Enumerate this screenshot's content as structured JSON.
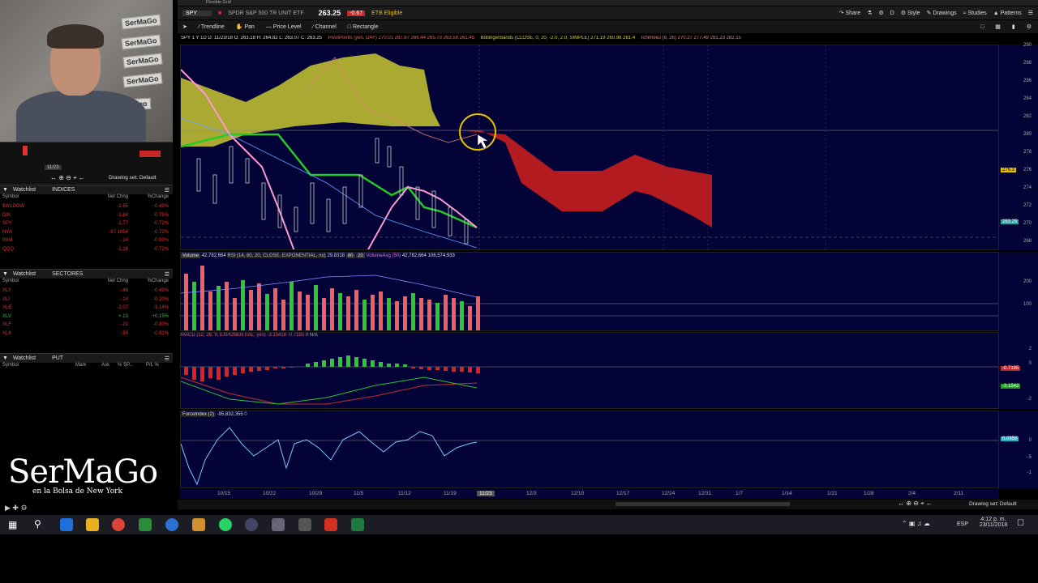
{
  "header": {
    "app_title": "Flexible Grid",
    "symbol": "SPY",
    "description": "SPDR S&P 500 TR UNIT ETF",
    "last_price": "263.25",
    "change_pct": "-0.67",
    "etb_label": "ETB Eligible",
    "share_label": "Share",
    "style_label": "Style",
    "drawings_label": "Drawings",
    "studies_label": "Studies",
    "patterns_label": "Patterns",
    "period_label": "D"
  },
  "drawing_tools": {
    "trendline": "Trendline",
    "pan": "Pan",
    "price_level": "Price Level",
    "channel": "Channel",
    "rectangle": "Rectangle"
  },
  "study_bar": {
    "ohlc": "SPY 1 Y 1D  D: 11/23/18  O: 263.18  H: 264.82  L: 263.07  C: 263.25",
    "pivot": "PivotPoints (yes, DAY)  270.01  267.87  266.44  265.73  263.59  261.45",
    "bollinger": "BollingerBands (CLOSE, 0, 20, -2.0, 2.0, SIMPLE)  271.19  260.98  281.4",
    "ichimoku": "Ichimoku (9, 26)  270.27  277.49  281.23  282.15"
  },
  "price_axis": [
    "290",
    "288",
    "286",
    "284",
    "282",
    "280",
    "278",
    "276",
    "274",
    "272",
    "270",
    "268"
  ],
  "price_tags": {
    "current": "263.25",
    "upper": "276.3"
  },
  "volume_pane": {
    "label": "Volume",
    "volume_value": "42,782,664",
    "rsi_label": "RSI (14, 80, 20, CLOSE, EXPONENTIAL, no)",
    "rsi_value": "29.8318",
    "rsi_hi": "80",
    "rsi_lo": "20",
    "volavg_label": "VolumeAvg (50)",
    "volavg_value": "42,782,664",
    "volavg2_value": "106,574,933",
    "axis": [
      "200",
      "100"
    ]
  },
  "macd_pane": {
    "label": "MACD (12, 26, 9, EXPONENTIAL, yes)",
    "value1": "-3.15418",
    "value2": "-0.7195",
    "value3": "0",
    "value4": "N/A",
    "axis_tag1": "-0.7195",
    "axis_tag2": "-3.1542",
    "axis": [
      "2",
      "0",
      "-2"
    ]
  },
  "force_pane": {
    "label": "ForceIndex (2)",
    "value": "-95,832,355",
    "zero": "0",
    "axis_tag": "0.0958",
    "axis": [
      "0",
      "-.5",
      "-1"
    ]
  },
  "date_axis": [
    "10/15",
    "10/22",
    "10/29",
    "11/5",
    "11/12",
    "11/19",
    "11/23",
    "12/3",
    "12/10",
    "12/17",
    "12/24",
    "12/31",
    "1/7",
    "1/14",
    "1/21",
    "1/28",
    "2/4",
    "2/11"
  ],
  "status": {
    "drawing_set_right": "Drawing set: Default",
    "drawing_set_left": "Drawing set: Default",
    "mini_date": "11/23"
  },
  "watchlists": [
    {
      "title": "Watchlist",
      "group": "INDICES",
      "cols": [
        "Symbol",
        "Net Chng",
        "%Change"
      ],
      "rows": [
        {
          "sym": "$W1DOW",
          "chg": "-1.65",
          "pct": "-0.45%"
        },
        {
          "sym": "DIA",
          "chg": "-1.84",
          "pct": "-0.75%"
        },
        {
          "sym": "SPY",
          "chg": "-1.77",
          "pct": "-0.72%"
        },
        {
          "sym": "NYA",
          "chg": "-87.1054",
          "pct": "-0.72%"
        },
        {
          "sym": "IWM",
          "chg": "-.14",
          "pct": "-0.09%"
        },
        {
          "sym": "QQQ",
          "chg": "-1.16",
          "pct": "-0.72%"
        }
      ]
    },
    {
      "title": "Watchlist",
      "group": "SECTORES",
      "cols": [
        "Symbol",
        "Net Chng",
        "%Change"
      ],
      "rows": [
        {
          "sym": "XLY",
          "chg": "-.46",
          "pct": "-0.45%"
        },
        {
          "sym": "XLI",
          "chg": "-.14",
          "pct": "-0.20%"
        },
        {
          "sym": "XLE",
          "chg": "-2.07",
          "pct": "-3.14%"
        },
        {
          "sym": "XLV",
          "chg": "+.13",
          "pct": "+0.15%"
        },
        {
          "sym": "XLF",
          "chg": "-.21",
          "pct": "-0.80%"
        },
        {
          "sym": "XLK",
          "chg": "-.59",
          "pct": "-0.91%"
        }
      ]
    },
    {
      "title": "Watchlist",
      "group": "PUT",
      "cols": [
        "Symbol",
        "Mark",
        "Ask",
        "% SP...",
        "P/L %"
      ],
      "rows": []
    }
  ],
  "brand": {
    "title": "SerMaGo",
    "subtitle": "en la Bolsa de New York"
  },
  "webcam_posters": [
    "SerMaGo",
    "SerMaGo",
    "SerMaGo",
    "SerMaGo",
    "Latinago"
  ],
  "taskbar": {
    "time": "4:12 p. m.",
    "date": "23/11/2018",
    "lang": "ESP"
  },
  "colors": {
    "pane_bg": "#030338",
    "cloud_bull": "#c8c832",
    "cloud_bear": "#c81e1e",
    "up": "#2ec82e",
    "down": "#f06060",
    "accent": "#e8c000"
  }
}
